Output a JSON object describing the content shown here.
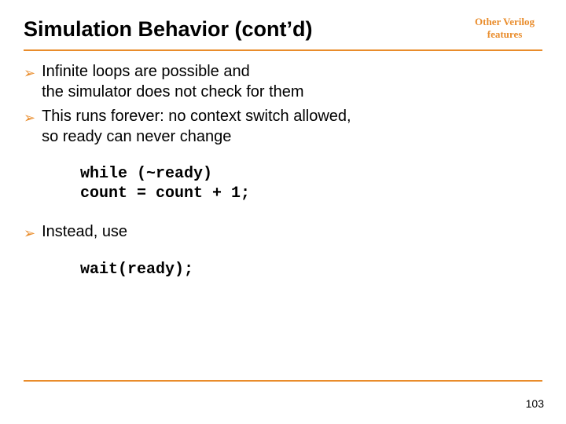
{
  "header": {
    "title": "Simulation Behavior (cont’d)",
    "tag_line1": "Other Verilog",
    "tag_line2": "features"
  },
  "bullets": {
    "b1_l1": "Infinite loops are possible and",
    "b1_l2": "the simulator does not check for them",
    "b2_l1": "This runs forever: no context switch allowed,",
    "b2_l2": "so ready can never change",
    "b3": "Instead, use"
  },
  "code": {
    "block1": "while (~ready)\ncount = count + 1;",
    "block2": "wait(ready);"
  },
  "page_number": "103"
}
